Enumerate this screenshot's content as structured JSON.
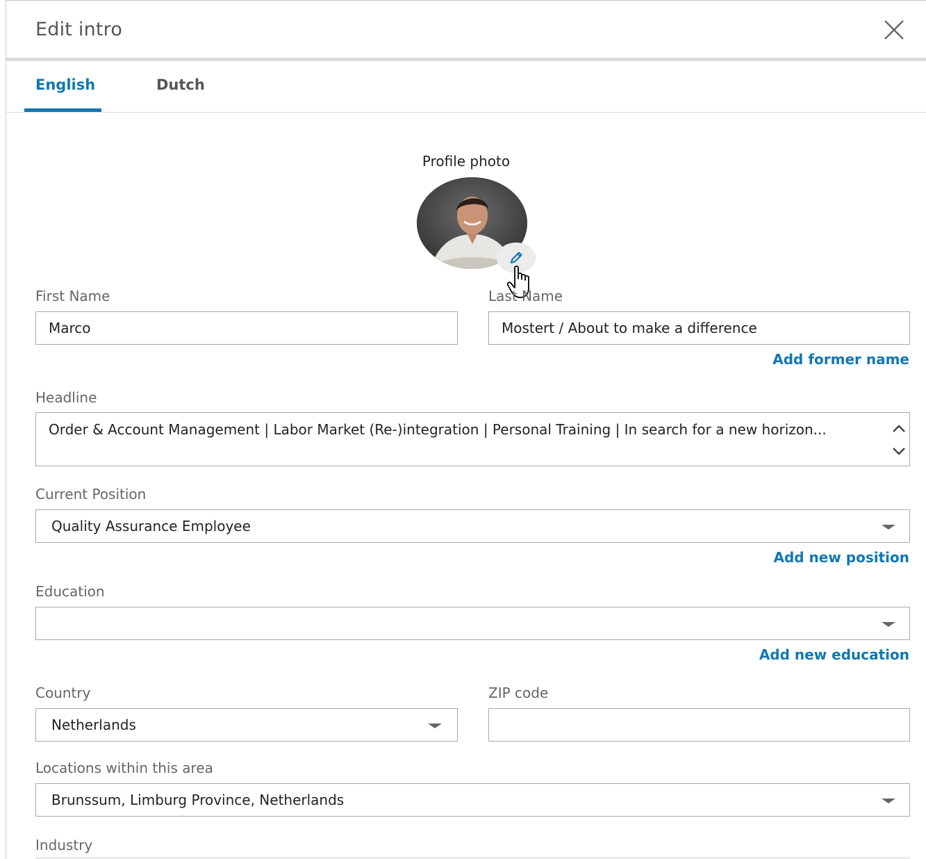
{
  "modal": {
    "title": "Edit intro",
    "close_label": "close"
  },
  "tabs": [
    {
      "label": "English",
      "active": true
    },
    {
      "label": "Dutch",
      "active": false
    }
  ],
  "profile_photo": {
    "label": "Profile photo"
  },
  "first_name": {
    "label": "First Name",
    "value": "Marco"
  },
  "last_name": {
    "label": "Last Name",
    "value": "Mostert / About to make a difference",
    "link": "Add former name"
  },
  "headline": {
    "label": "Headline",
    "value": "Order & Account Management | Labor Market (Re-)integration | Personal Training | In search for a new horizon..."
  },
  "current_position": {
    "label": "Current Position",
    "value": "Quality Assurance Employee",
    "link": "Add new position"
  },
  "education": {
    "label": "Education",
    "value": "",
    "link": "Add new education"
  },
  "country": {
    "label": "Country",
    "value": "Netherlands"
  },
  "zip": {
    "label": "ZIP code",
    "value": ""
  },
  "locations": {
    "label": "Locations within this area",
    "value": "Brunssum, Limburg Province, Netherlands"
  },
  "industry": {
    "label": "Industry"
  },
  "colors": {
    "accent": "#1178b3",
    "label_gray": "#666666",
    "border": "#a8a8a8"
  },
  "icons": [
    "close-icon",
    "pencil-icon",
    "hand-cursor-icon",
    "chevron-up-icon",
    "chevron-down-icon",
    "caret-down-icon"
  ]
}
